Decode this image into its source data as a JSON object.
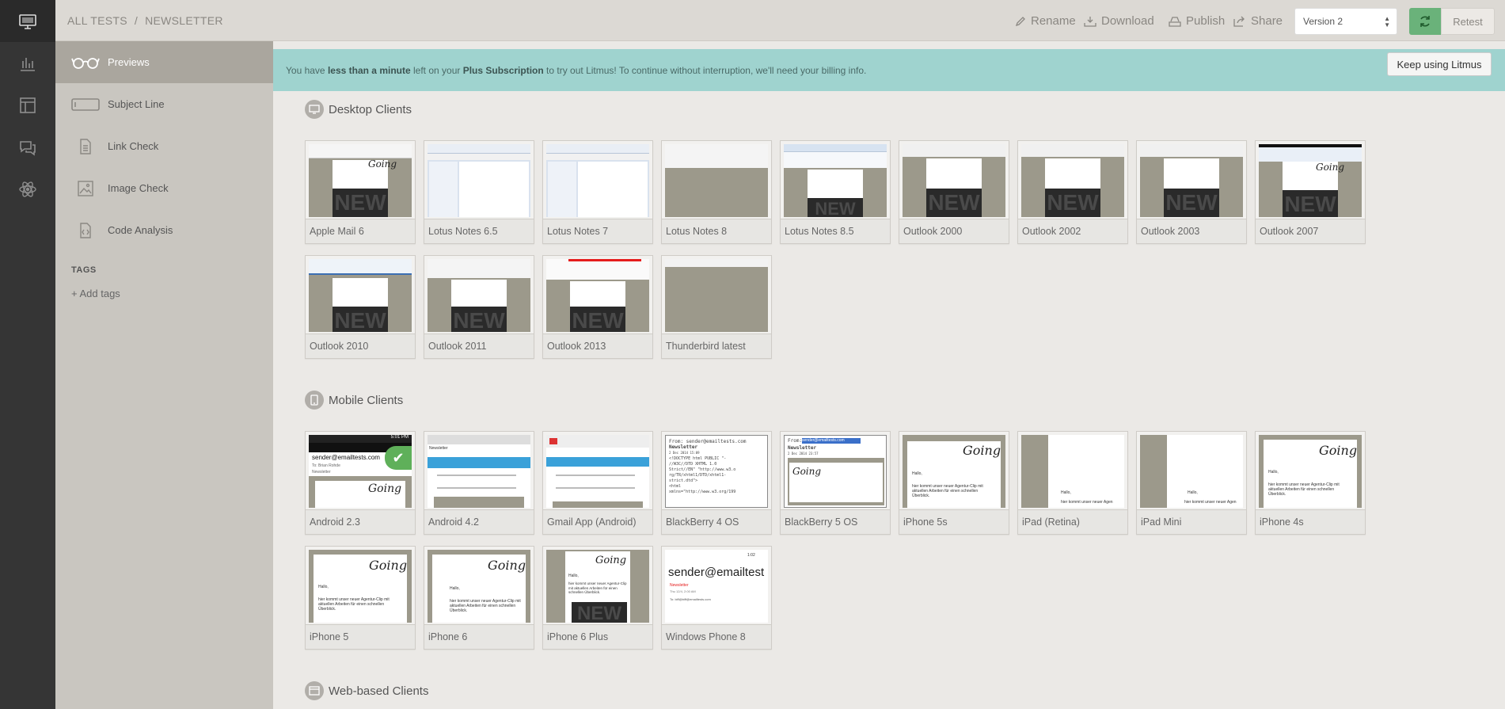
{
  "breadcrumb": {
    "root": "ALL TESTS",
    "separator": "/",
    "current": "NEWSLETTER"
  },
  "toolbar": {
    "rename": "Rename",
    "download": "Download",
    "publish": "Publish",
    "share": "Share",
    "version": "Version 2",
    "retest": "Retest"
  },
  "rail": {
    "icons": [
      "desktop-icon",
      "bar-chart-icon",
      "layout-icon",
      "chat-icon",
      "atom-icon"
    ]
  },
  "sidebar": {
    "items": [
      {
        "label": "Previews",
        "icon": "glasses-icon"
      },
      {
        "label": "Subject Line",
        "icon": "subject-icon"
      },
      {
        "label": "Link Check",
        "icon": "document-icon"
      },
      {
        "label": "Image Check",
        "icon": "image-icon"
      },
      {
        "label": "Code Analysis",
        "icon": "code-icon"
      }
    ],
    "tags_title": "TAGS",
    "add_tags": "+ Add tags"
  },
  "banner": {
    "pre": "You have ",
    "bold1": "less than a minute",
    "mid": " left on your ",
    "bold2": "Plus Subscription",
    "post": " to try out Litmus! To continue without interruption, we'll need your billing info.",
    "button": "Keep using Litmus"
  },
  "sections": {
    "desktop": {
      "title": "Desktop Clients",
      "clients": [
        "Apple Mail 6",
        "Lotus Notes 6.5",
        "Lotus Notes 7",
        "Lotus Notes 8",
        "Lotus Notes 8.5",
        "Outlook 2000",
        "Outlook 2002",
        "Outlook 2003",
        "Outlook 2007",
        "Outlook 2010",
        "Outlook 2011",
        "Outlook 2013",
        "Thunderbird latest"
      ]
    },
    "mobile": {
      "title": "Mobile Clients",
      "clients": [
        "Android 2.3",
        "Android 4.2",
        "Gmail App (Android)",
        "BlackBerry 4 OS",
        "BlackBerry 5 OS",
        "iPhone 5s",
        "iPad (Retina)",
        "iPad Mini",
        "iPhone 4s",
        "iPhone 5",
        "iPhone 6",
        "iPhone 6 Plus",
        "Windows Phone 8"
      ]
    },
    "web": {
      "title": "Web-based Clients"
    }
  },
  "thumb_text": {
    "new": "NEW",
    "sender": "sender@emailtests.com",
    "sender_short": "sender@emailtest",
    "newsletter": "Newsletter",
    "hello": "Hallo,",
    "body": "hier kommt unser neuer Agentur-Clip mit aktuellen Arbeiten für einen schnellen Überblick.",
    "body_short": "hier kommt unser neuer Agen",
    "bb4_code": "<!DOCTYPE html PUBLIC \"-\n//W3C//DTD XHTML 1.0\nStrict//EN\" \"http://www.w3.o\nrg/TR/xhtml1/DTD/xhtml1-\nstrict.dtd\">\n<html\nxmlns=\"http://www.w3.org/199",
    "bb4_from": "From: sender@emailtests.com",
    "bb4_sub": "Newsletter",
    "bb4_date": "2 Dec 2014 15:09",
    "bb5_from": "From:",
    "bb5_date": "2 Dec 2014 23:57",
    "wp_time": "1:02",
    "wp_date": "Thu 12/4, 2:00 AM",
    "wp_to": "To: biff@biff@emailtests.com",
    "android_time": "5:01 PM",
    "android_to": "To: Brian Rohde",
    "android_nl": "Newsletter",
    "sig": "Going"
  },
  "colors": {
    "accent": "#e4543a",
    "banner": "#9fd3cf",
    "sync": "#6ab27a",
    "rail": "#353535",
    "sidebar": "#c9c6c0"
  }
}
